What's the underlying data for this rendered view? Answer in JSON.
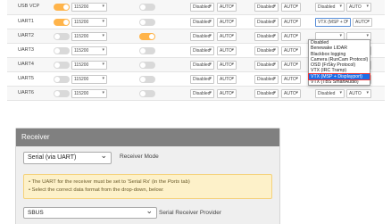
{
  "ports": {
    "rows": [
      {
        "name": "USB VCP",
        "msp": "on",
        "baud": "115200",
        "toggle2": "off",
        "telemetry": "Disabled",
        "telemetry_baud": "AUTO",
        "sensor": "Disabled",
        "sensor_baud": "AUTO",
        "periph": "Disabled",
        "periph_baud": "AUTO"
      },
      {
        "name": "UART1",
        "msp": "on",
        "baud": "115200",
        "toggle2": "off",
        "telemetry": "Disabled",
        "telemetry_baud": "AUTO",
        "sensor": "Disabled",
        "sensor_baud": "AUTO",
        "periph": "VTX (MSP + D",
        "periph_baud": "AUTO"
      },
      {
        "name": "UART2",
        "msp": "off",
        "baud": "115200",
        "toggle2": "on",
        "telemetry": "Disabled",
        "telemetry_baud": "AUTO",
        "sensor": "Disabled",
        "sensor_baud": "AUTO",
        "periph": "",
        "periph_baud": ""
      },
      {
        "name": "UART3",
        "msp": "off",
        "baud": "115200",
        "toggle2": "off",
        "telemetry": "Disabled",
        "telemetry_baud": "AUTO",
        "sensor": "Disabled",
        "sensor_baud": "AUTO",
        "periph": "",
        "periph_baud": ""
      },
      {
        "name": "UART4",
        "msp": "off",
        "baud": "115200",
        "toggle2": "off",
        "telemetry": "Disabled",
        "telemetry_baud": "AUTO",
        "sensor": "Disabled",
        "sensor_baud": "AUTO",
        "periph": "",
        "periph_baud": ""
      },
      {
        "name": "UART5",
        "msp": "off",
        "baud": "115200",
        "toggle2": "off",
        "telemetry": "Disabled",
        "telemetry_baud": "AUTO",
        "sensor": "Disabled",
        "sensor_baud": "AUTO",
        "periph": "",
        "periph_baud": ""
      },
      {
        "name": "UART6",
        "msp": "off",
        "baud": "115200",
        "toggle2": "off",
        "telemetry": "Disabled",
        "telemetry_baud": "AUTO",
        "sensor": "Disabled",
        "sensor_baud": "AUTO",
        "periph": "Disabled",
        "periph_baud": "AUTO"
      }
    ],
    "dropdown": {
      "options": [
        "Disabled",
        "Benewake LIDAR",
        "Blackbox logging",
        "Camera (RunCam Protocol)",
        "OSD (FrSky Protocol)",
        "VTX (IRC Tramp)",
        "VTX (MSP + Displayport)",
        "VTX (TBS SmartAudio)"
      ],
      "selected_index": 6
    }
  },
  "receiver": {
    "title": "Receiver",
    "mode_value": "Serial (via UART)",
    "mode_label": "Receiver Mode",
    "note_line1_pre": "• The UART for the receiver must be set to 'Serial Rx' (in the ",
    "note_line1_em": "Ports",
    "note_line1_post": " tab)",
    "note_line2": "• Select the correct data format from the drop-down, below:",
    "provider_value": "SBUS",
    "provider_label": "Serial Receiver Provider"
  }
}
